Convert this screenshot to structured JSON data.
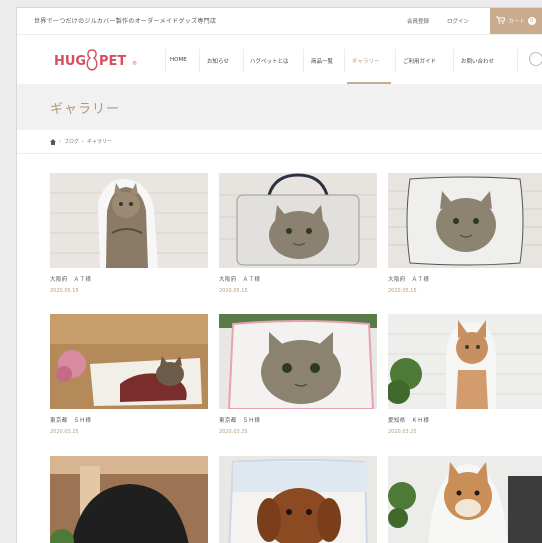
{
  "header": {
    "tagline": "世界で一つだけのジルカバー製作のオーダーメイドグッズ専門店",
    "links": [
      "会員登録",
      "ログイン"
    ],
    "cart_count": "0"
  },
  "logo": {
    "text_left": "HUG",
    "text_right": "PET",
    "brand_color": "#d64f5d"
  },
  "nav": {
    "items": [
      "HOME",
      "お知らせ",
      "ハグペットとは",
      "商品一覧",
      "ギャラリー",
      "ご利用ガイド",
      "お問い合わせ"
    ],
    "active_index": 4
  },
  "page": {
    "title": "ギャラリー",
    "breadcrumb": [
      "ブログ",
      "ギャラリー"
    ],
    "accent_color": "#c9ab8e"
  },
  "gallery": [
    {
      "title": "大阪府　ＡＴ様",
      "date": "2020.05.15"
    },
    {
      "title": "大阪府　ＡＴ様",
      "date": "2020.05.15"
    },
    {
      "title": "大阪府　ＡＴ様",
      "date": "2020.05.15"
    },
    {
      "title": "東京都　ＳＨ様",
      "date": "2020.03.25"
    },
    {
      "title": "東京都　ＳＨ様",
      "date": "2020.03.25"
    },
    {
      "title": "愛知県　ＫＨ様",
      "date": "2020.03.25"
    },
    {
      "title": "",
      "date": ""
    },
    {
      "title": "",
      "date": ""
    },
    {
      "title": "",
      "date": ""
    }
  ],
  "icons": {
    "cart": "cart-icon",
    "home": "home-icon",
    "search": "search-icon"
  }
}
